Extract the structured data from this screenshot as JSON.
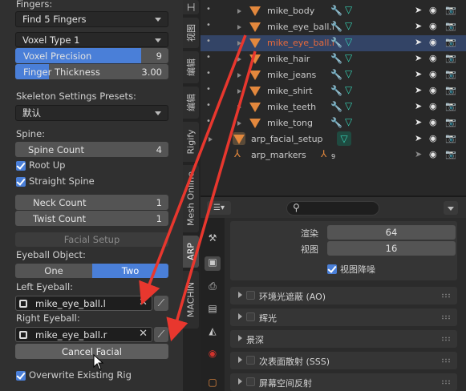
{
  "left_panel": {
    "fingers_label": "Fingers:",
    "fingers_dropdown": "Find 5 Fingers",
    "voxel_type": "Voxel Type 1",
    "voxel_precision": {
      "label": "Voxel Precision",
      "value": "9",
      "fill": 0.82
    },
    "finger_thickness": {
      "label": "Finger Thickness",
      "value": "3.00",
      "fill": 0.22
    },
    "skeleton_presets_label": "Skeleton Settings Presets:",
    "skeleton_presets_value": "默认",
    "spine_label": "Spine:",
    "spine_count": {
      "label": "Spine Count",
      "value": "4"
    },
    "root_up": "Root Up",
    "straight_spine": "Straight Spine",
    "neck_count": {
      "label": "Neck Count",
      "value": "1"
    },
    "twist_count": {
      "label": "Twist Count",
      "value": "1"
    },
    "facial_setup": "Facial Setup",
    "eyeball_object_label": "Eyeball Object:",
    "eyeball_one": "One",
    "eyeball_two": "Two",
    "left_eyeball_label": "Left Eyeball:",
    "left_eyeball_value": "mike_eye_ball.l",
    "right_eyeball_label": "Right Eyeball:",
    "right_eyeball_value": "mike_eye_ball.r",
    "cancel_facial": "Cancel Facial",
    "overwrite_rig": "Overwrite Existing Rig"
  },
  "side_tabs": [
    "工",
    "视图",
    "编辑",
    "编辑",
    "Rigify",
    "Mesh Online",
    "ARP",
    "MACHIN"
  ],
  "outliner": {
    "items": [
      {
        "name": "mike_body",
        "selected": false
      },
      {
        "name": "mike_eye_ball.l",
        "selected": false
      },
      {
        "name": "mike_eye_ball.r",
        "selected": true
      },
      {
        "name": "mike_hair",
        "selected": false
      },
      {
        "name": "mike_jeans",
        "selected": false
      },
      {
        "name": "mike_shirt",
        "selected": false
      },
      {
        "name": "mike_teeth",
        "selected": false
      },
      {
        "name": "mike_tong",
        "selected": false
      }
    ],
    "facial_setup": "arp_facial_setup",
    "markers": "arp_markers",
    "markers_count": "9"
  },
  "properties": {
    "render_label": "渲染",
    "render_value": "64",
    "viewport_label": "视图",
    "viewport_value": "16",
    "viewport_denoise": "视图降噪",
    "sections": [
      "环境光遮蔽 (AO)",
      "辉光",
      "景深",
      "次表面散射 (SSS)",
      "屏幕空间反射"
    ]
  },
  "colors": {
    "accent": "#4a7fd8",
    "arrow": "#e8372e",
    "selected_text": "#e86a3a"
  }
}
